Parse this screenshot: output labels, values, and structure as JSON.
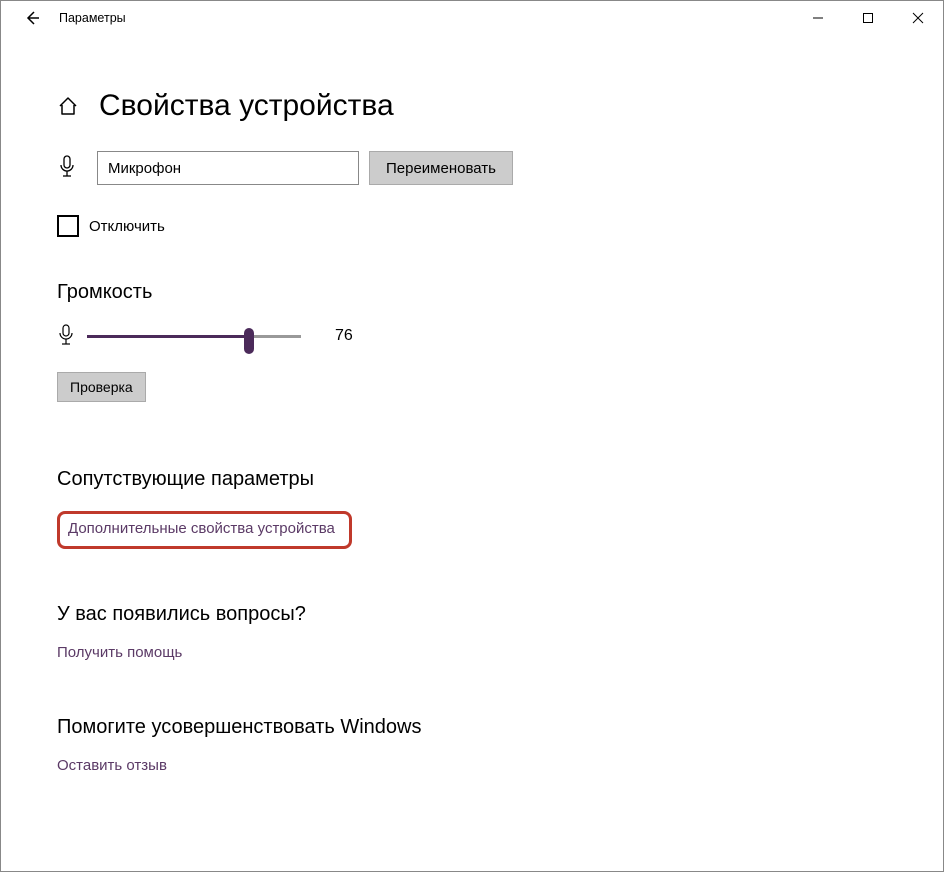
{
  "titlebar": {
    "label": "Параметры"
  },
  "page": {
    "heading": "Свойства устройства"
  },
  "device": {
    "name_value": "Микрофон",
    "rename_button": "Переименовать",
    "disable_label": "Отключить"
  },
  "volume": {
    "heading": "Громкость",
    "value": "76",
    "test_button": "Проверка"
  },
  "related": {
    "heading": "Сопутствующие параметры",
    "link": "Дополнительные свойства устройства"
  },
  "questions": {
    "heading": "У вас появились вопросы?",
    "link": "Получить помощь"
  },
  "improve": {
    "heading": "Помогите усовершенствовать Windows",
    "link": "Оставить отзыв"
  },
  "colors": {
    "accent": "#4b2a5a",
    "link": "#5b3a66",
    "highlight": "#c0392b"
  }
}
